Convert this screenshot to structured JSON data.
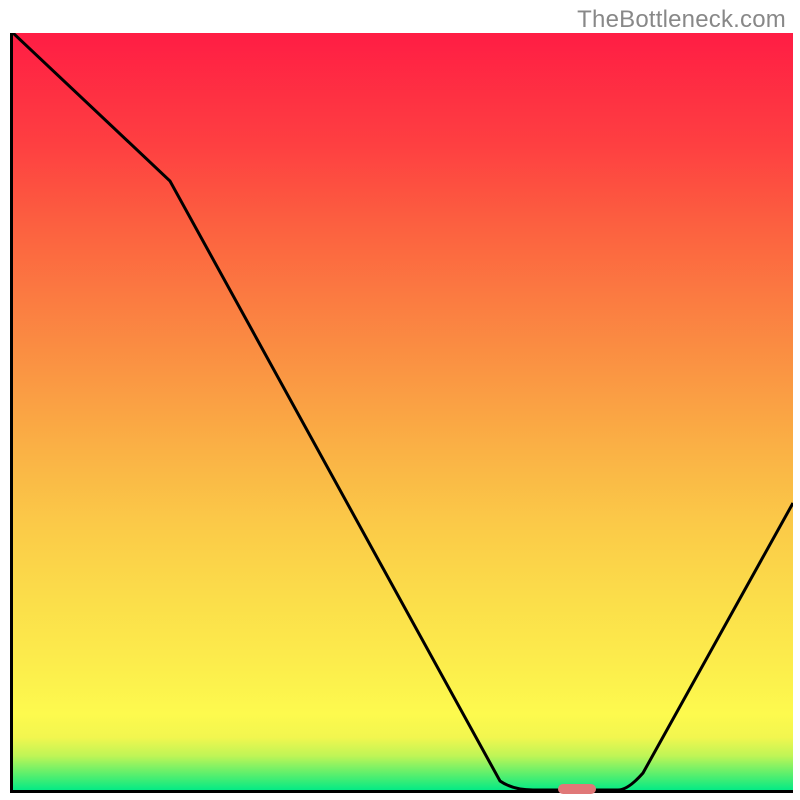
{
  "watermark_text": "TheBottleneck.com",
  "colors": {
    "axis": "#000000",
    "curve": "#000000",
    "marker": "#e07878",
    "watermark": "#888888",
    "gradient_top": "#ff1d44",
    "gradient_bottom": "#05ea85"
  },
  "chart_data": {
    "type": "line",
    "title": "",
    "xlabel": "",
    "ylabel": "",
    "xlim": [
      0,
      100
    ],
    "ylim": [
      0,
      100
    ],
    "x": [
      0,
      20,
      63,
      70,
      78,
      100
    ],
    "values": [
      100,
      80,
      1,
      0,
      0,
      38
    ],
    "marker_x_range": [
      70,
      75
    ],
    "marker_y": 0,
    "note": "Values read as percentage of plot height from bottom; x as percentage of plot width."
  }
}
